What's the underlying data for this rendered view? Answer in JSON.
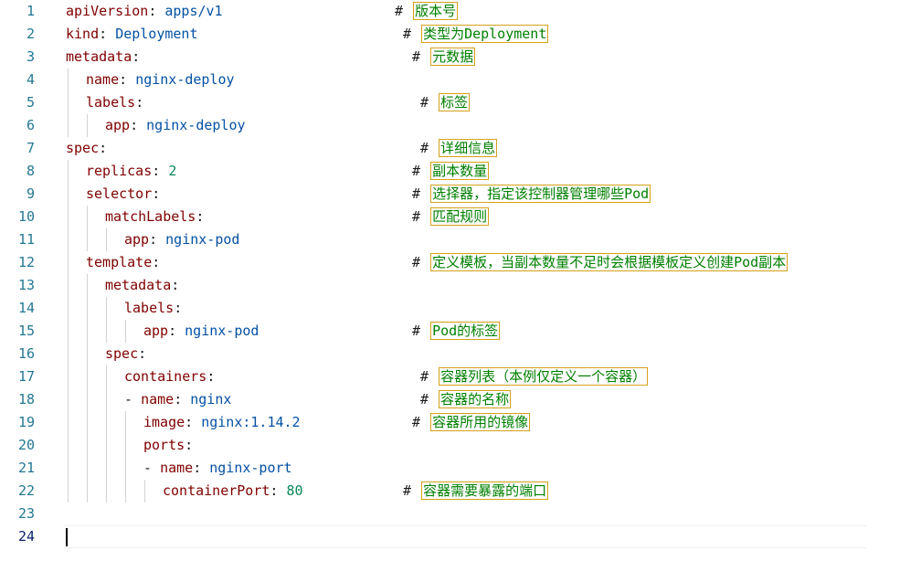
{
  "lines": [
    {
      "no": "1",
      "key": "apiVersion",
      "colon": ":",
      "sp": " ",
      "value": "apps/v1",
      "comment": "版本号"
    },
    {
      "no": "2",
      "key": "kind",
      "colon": ":",
      "sp": " ",
      "value": "Deployment",
      "comment": "类型为Deployment"
    },
    {
      "no": "3",
      "key": "metadata",
      "colon": ":",
      "comment": "元数据"
    },
    {
      "no": "4",
      "key": "name",
      "colon": ":",
      "sp": " ",
      "value": "nginx-deploy"
    },
    {
      "no": "5",
      "key": "labels",
      "colon": ":",
      "comment": "标签"
    },
    {
      "no": "6",
      "key": "app",
      "colon": ":",
      "sp": " ",
      "value": "nginx-deploy"
    },
    {
      "no": "7",
      "key": "spec",
      "colon": ":",
      "comment": "详细信息"
    },
    {
      "no": "8",
      "key": "replicas",
      "colon": ":",
      "sp": " ",
      "value": "2",
      "comment": "副本数量"
    },
    {
      "no": "9",
      "key": "selector",
      "colon": ":",
      "comment": "选择器，指定该控制器管理哪些Pod"
    },
    {
      "no": "10",
      "key": "matchLabels",
      "colon": ":",
      "comment": "匹配规则"
    },
    {
      "no": "11",
      "key": "app",
      "colon": ":",
      "sp": " ",
      "value": "nginx-pod"
    },
    {
      "no": "12",
      "key": "template",
      "colon": ":",
      "comment": "定义模板，当副本数量不足时会根据模板定义创建Pod副本"
    },
    {
      "no": "13",
      "key": "metadata",
      "colon": ":"
    },
    {
      "no": "14",
      "key": "labels",
      "colon": ":"
    },
    {
      "no": "15",
      "key": "app",
      "colon": ":",
      "sp": " ",
      "value": "nginx-pod",
      "comment": "Pod的标签"
    },
    {
      "no": "16",
      "key": "spec",
      "colon": ":"
    },
    {
      "no": "17",
      "key": "containers",
      "colon": ":",
      "comment": "容器列表（本例仅定义一个容器）"
    },
    {
      "no": "18",
      "dash": "- ",
      "key": "name",
      "colon": ":",
      "sp": " ",
      "value": "nginx",
      "comment": "容器的名称"
    },
    {
      "no": "19",
      "key": "image",
      "colon": ":",
      "sp": " ",
      "value": "nginx:1.14.2",
      "comment": "容器所用的镜像"
    },
    {
      "no": "20",
      "key": "ports",
      "colon": ":"
    },
    {
      "no": "21",
      "dash": "- ",
      "key": "name",
      "colon": ":",
      "sp": " ",
      "value": "nginx-port"
    },
    {
      "no": "22",
      "key": "containerPort",
      "colon": ":",
      "sp": " ",
      "value": "80",
      "comment": "容器需要暴露的端口"
    },
    {
      "no": "23"
    },
    {
      "no": "24"
    }
  ],
  "comment_marker": "# ",
  "colors": {
    "line_number": "#237893",
    "key": "#800000",
    "string_value": "#0451a5",
    "number_value": "#098658",
    "comment_text": "#008000",
    "comment_highlight_border": "#d4a11a",
    "indent_guide": "#d3d3d3"
  }
}
